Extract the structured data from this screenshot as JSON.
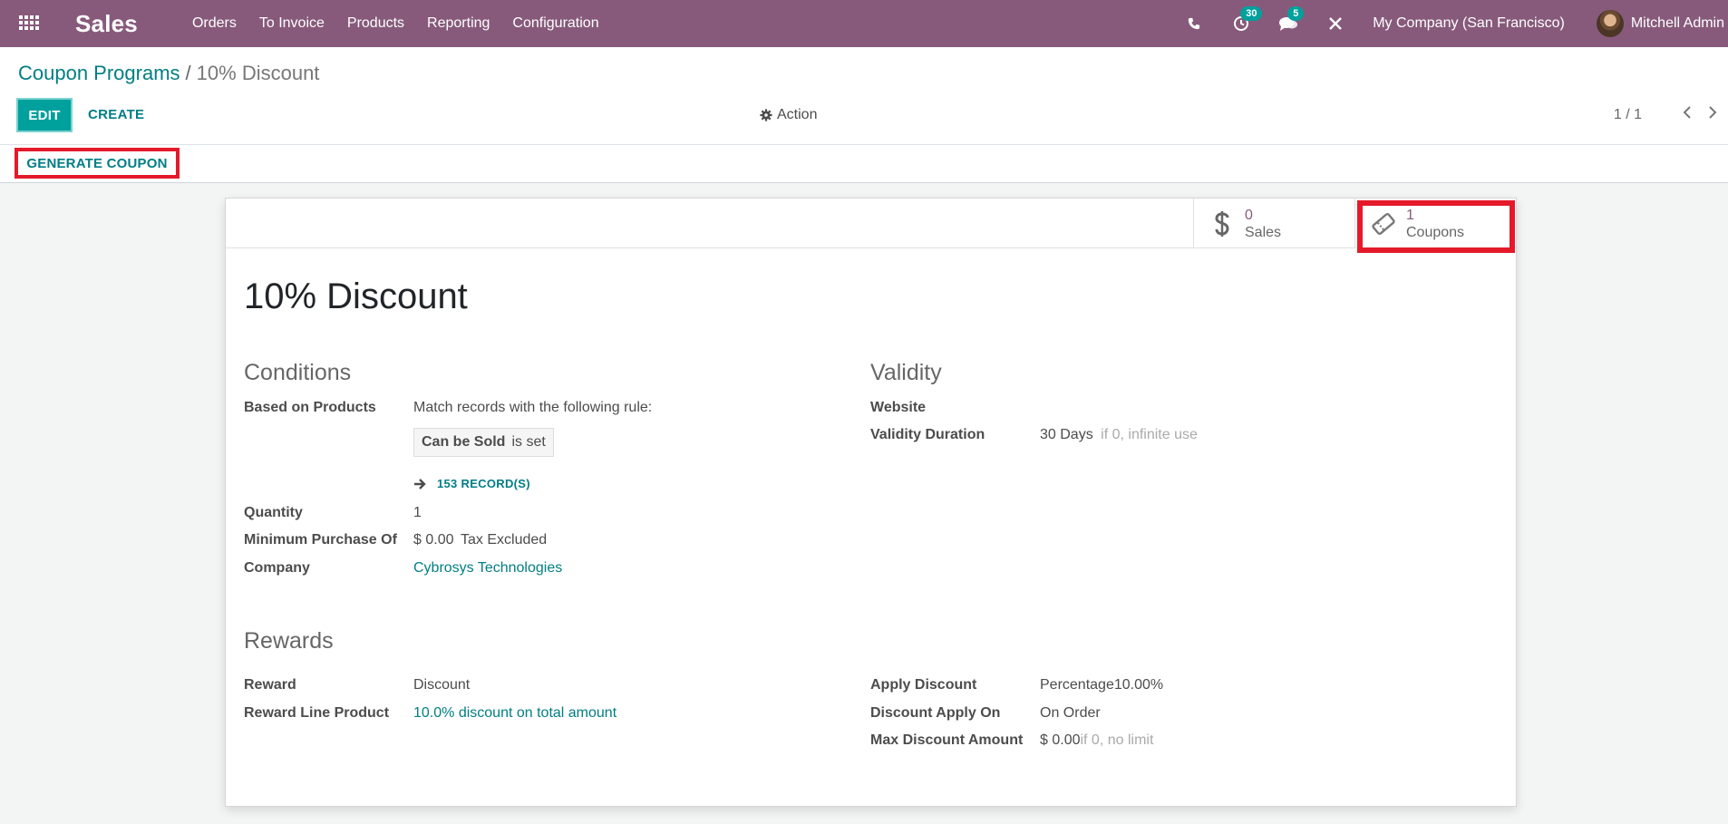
{
  "navbar": {
    "app_name": "Sales",
    "menu": [
      "Orders",
      "To Invoice",
      "Products",
      "Reporting",
      "Configuration"
    ],
    "activity_count": "30",
    "message_count": "5",
    "company": "My Company (San Francisco)",
    "user": "Mitchell Admin"
  },
  "breadcrumb": {
    "parent": "Coupon Programs",
    "separator": "/",
    "current": "10% Discount"
  },
  "control": {
    "edit": "EDIT",
    "create": "CREATE",
    "action": "Action",
    "pager": "1 / 1"
  },
  "statusbar": {
    "generate": "GENERATE COUPON"
  },
  "stats": {
    "sales_count": "0",
    "sales_label": "Sales",
    "coupons_count": "1",
    "coupons_label": "Coupons"
  },
  "record": {
    "title": "10% Discount",
    "conditions": {
      "heading": "Conditions",
      "based_on_products_label": "Based on Products",
      "rule_text": "Match records with the following rule:",
      "rule_field": "Can be Sold",
      "rule_op": "is set",
      "records": "153 RECORD(S)",
      "quantity_label": "Quantity",
      "quantity": "1",
      "min_purchase_label": "Minimum Purchase Of",
      "min_purchase": "$ 0.00",
      "tax_mode": "Tax Excluded",
      "company_label": "Company",
      "company": "Cybrosys Technologies"
    },
    "validity": {
      "heading": "Validity",
      "website_label": "Website",
      "duration_label": "Validity Duration",
      "duration": "30 Days",
      "duration_hint": "if 0, infinite use"
    },
    "rewards": {
      "heading": "Rewards",
      "reward_label": "Reward",
      "reward": "Discount",
      "line_product_label": "Reward Line Product",
      "line_product": "10.0% discount on total amount",
      "apply_discount_label": "Apply Discount",
      "apply_discount": "Percentage10.00%",
      "apply_on_label": "Discount Apply On",
      "apply_on": "On Order",
      "max_label": "Max Discount Amount",
      "max": "$ 0.00",
      "max_hint": "if 0, no limit"
    }
  },
  "colors": {
    "brand": "#875a7b",
    "accent": "#00a09d",
    "link": "#017e84",
    "highlight": "#e41a2b"
  }
}
